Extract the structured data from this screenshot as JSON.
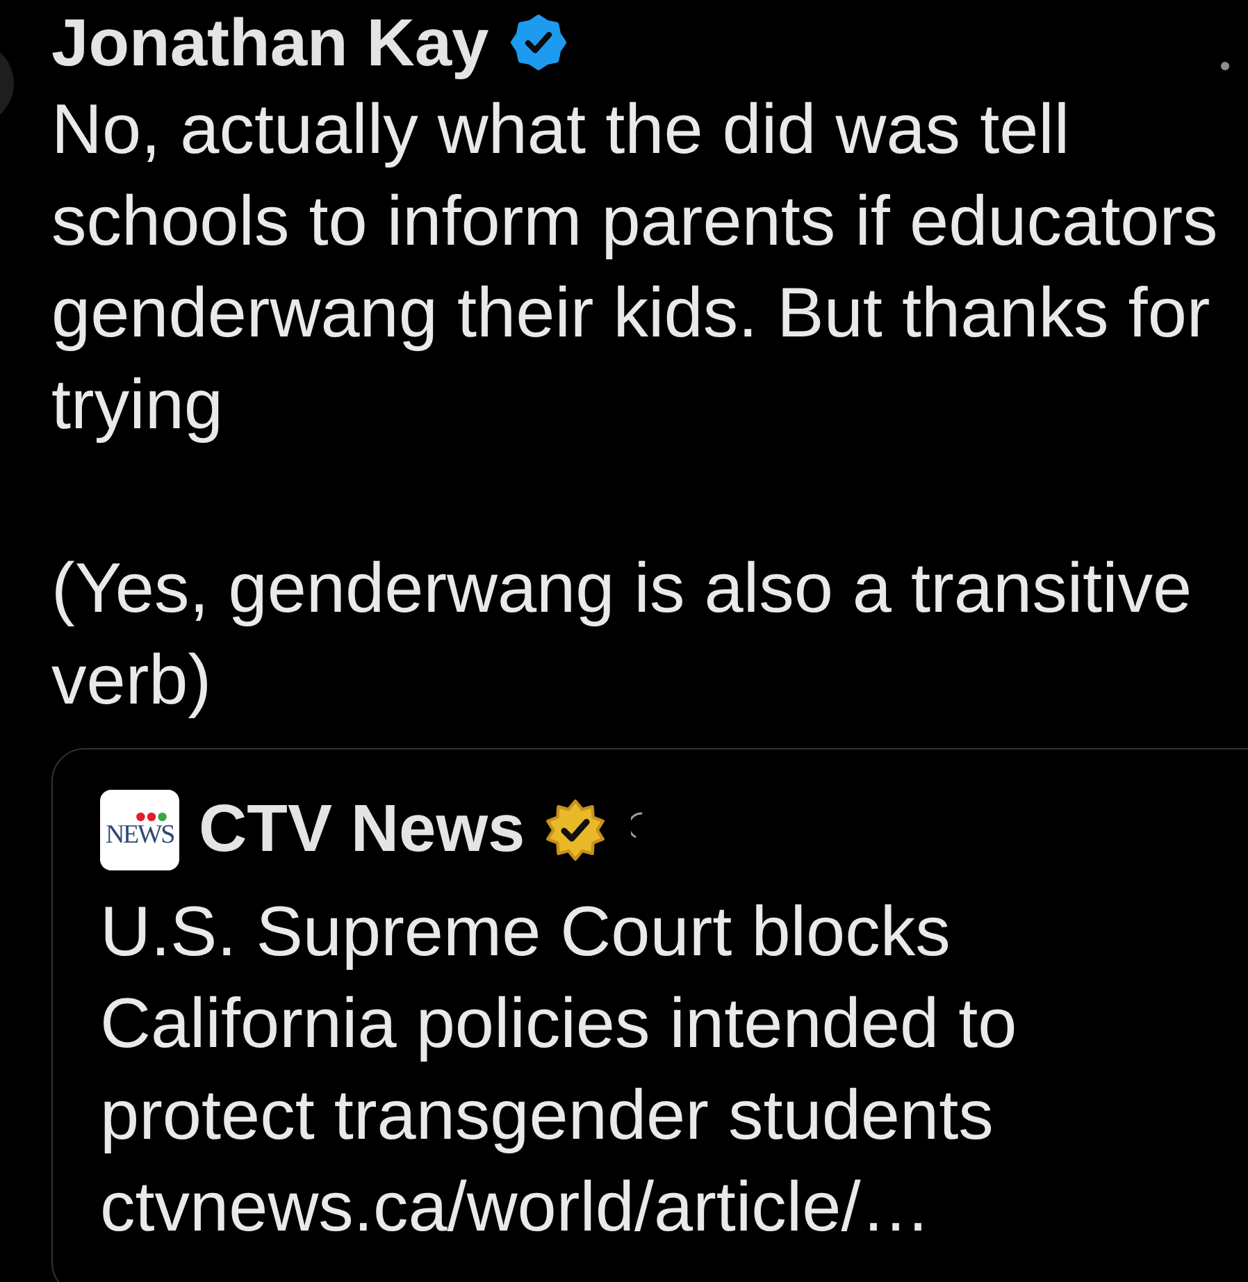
{
  "author": {
    "name": "Jonathan Kay",
    "badge": {
      "kind": "blue"
    }
  },
  "text": [
    "No, actually what the did was tell schools to inform parents if educators genderwang their kids. But thanks for trying",
    "(Yes, genderwang is also a transitive verb)"
  ],
  "quote": {
    "logo_text": "NEWS",
    "author": {
      "name": "CTV News",
      "badge": {
        "kind": "gold"
      }
    },
    "text": "U.S. Supreme Court blocks California policies intended to protect transgender students",
    "link": "ctvnews.ca/world/article/…"
  }
}
